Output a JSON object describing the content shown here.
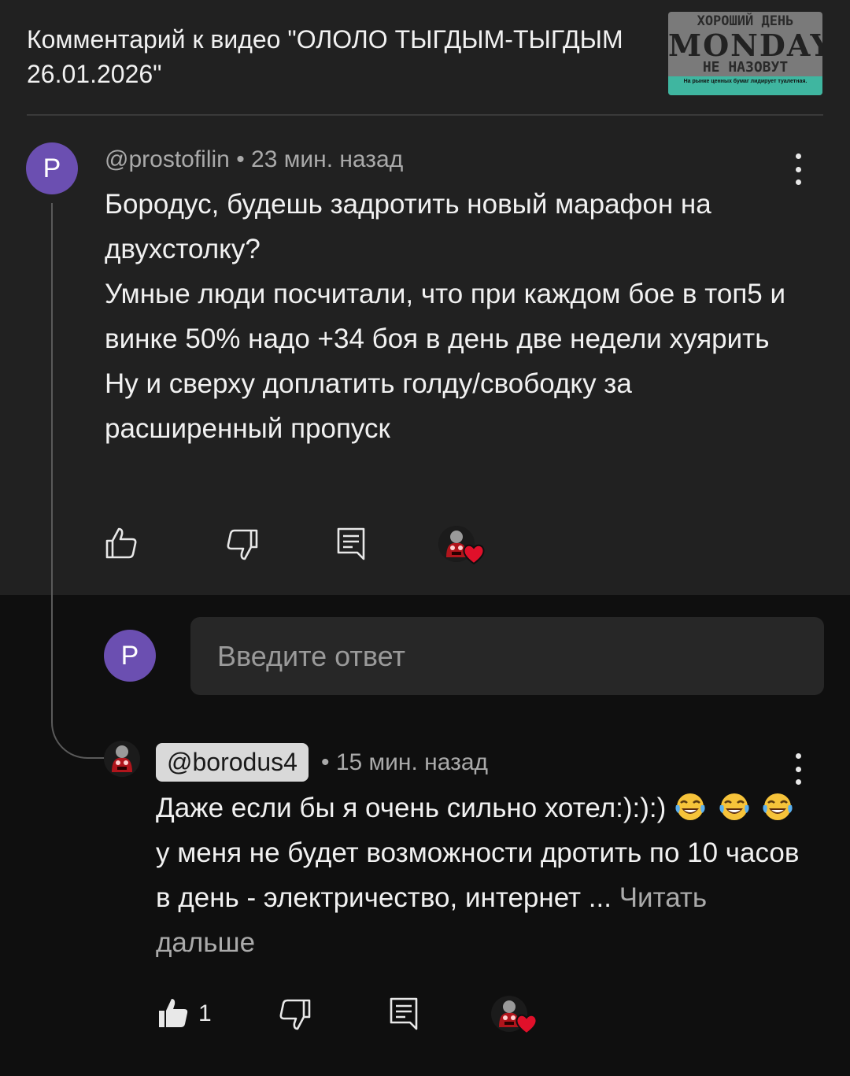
{
  "header": {
    "title": "Комментарий к видео \"ОЛОЛО ТЫГДЫМ-ТЫГДЫМ 26.01.2026\"",
    "thumbnail": {
      "line1": "ХОРОШИЙ ДЕНЬ",
      "line2": "MONDAY",
      "line3": "НЕ НАЗОВУТ",
      "caption": "На рынке ценных бумаг лидирует туалетная."
    }
  },
  "comment": {
    "avatar_letter": "P",
    "author": "@prostofilin",
    "time": "• 23 мин. назад",
    "lines": [
      "Бородус, будешь задротить новый марафон на двухстолку?",
      "Умные люди посчитали, что при каждом бое в топ5 и винке 50% надо +34 боя в день две недели хуярить",
      "Ну и сверху доплатить голду/свободку за расширенный пропуск"
    ]
  },
  "reply_box": {
    "avatar_letter": "P",
    "placeholder": "Введите ответ"
  },
  "reply": {
    "author": "@borodus4",
    "time": "• 15 мин. назад",
    "text_a": "Даже если бы я очень сильно хотел:):):)",
    "text_b": "у меня не будет возможности дротить по 10 часов в день - электричество, интернет ...",
    "read_more": "Читать дальше",
    "like_count": "1"
  },
  "icons": {
    "like": "thumb-up-icon",
    "dislike": "thumb-down-icon",
    "reply": "reply-comment-icon",
    "heart": "creator-heart-icon",
    "more": "more-vert-icon",
    "emoji": "face-with-tears-of-joy"
  },
  "colors": {
    "avatar": "#6b4fb1",
    "heart": "#e0102a",
    "top_bg": "#212121",
    "bottom_bg": "#0f0f0f"
  }
}
